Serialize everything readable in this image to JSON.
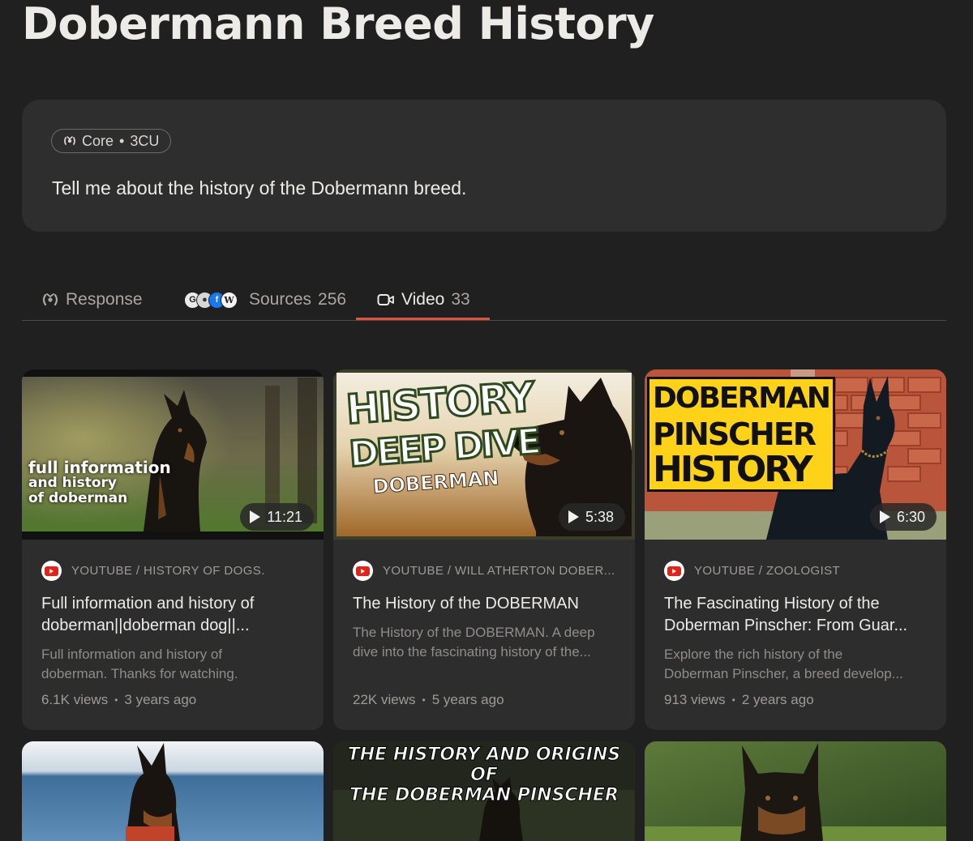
{
  "page": {
    "title": "Dobermann Breed History"
  },
  "query": {
    "model_chip": {
      "name": "Core",
      "separator": "•",
      "cost": "3CU"
    },
    "text": "Tell me about the history of the Dobermann breed."
  },
  "tabs": [
    {
      "label": "Response",
      "count": ""
    },
    {
      "label": "Sources",
      "count": "256"
    },
    {
      "label": "Video",
      "count": "33",
      "active": true
    }
  ],
  "videos": [
    {
      "source": "YOUTUBE / HISTORY OF DOGS.",
      "title_line1": "Full information and history of",
      "title_line2": "doberman||doberman dog||...",
      "desc_line1": "Full information and history of",
      "desc_line2": "doberman. Thanks for watching.",
      "views": "6.1K views",
      "age": "3 years ago",
      "duration": "11:21",
      "thumb_text": [
        "full information",
        "and history",
        "of doberman"
      ]
    },
    {
      "source": "YOUTUBE / WILL ATHERTON DOBER...",
      "title_line1": "The History of the DOBERMAN",
      "title_line2": "",
      "desc_line1": "The History of the DOBERMAN. A deep",
      "desc_line2": "dive into the fascinating history of the...",
      "views": "22K views",
      "age": "5 years ago",
      "duration": "5:38",
      "thumb_text": [
        "HISTORY",
        "DEEP DIVE",
        "DOBERMAN"
      ]
    },
    {
      "source": "YOUTUBE / ZOOLOGIST",
      "title_line1": "The Fascinating History of the",
      "title_line2": "Doberman Pinscher: From Guar...",
      "desc_line1": "Explore the rich history of the",
      "desc_line2": "Doberman Pinscher, a breed develop...",
      "views": "913 views",
      "age": "2 years ago",
      "duration": "6:30",
      "thumb_text": [
        "DOBERMAN",
        "PINSCHER",
        "HISTORY"
      ]
    }
  ],
  "partial_row": {
    "middle_thumb_text": [
      "THE HISTORY AND ORIGINS OF",
      "THE DOBERMAN PINSCHER"
    ]
  },
  "meta_separator": "•",
  "colors": {
    "accent": "#e0543e",
    "background": "#202020",
    "card": "#2d2d2d"
  }
}
